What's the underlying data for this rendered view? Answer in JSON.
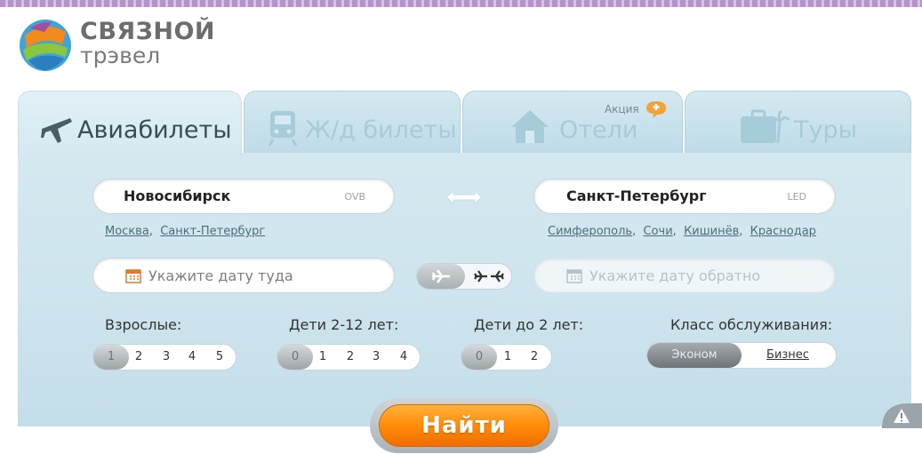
{
  "brand": {
    "name": "СВЯЗНОЙ",
    "sub": "трэвел"
  },
  "tabs": [
    {
      "label": "Авиабилеты",
      "icon": "plane-icon",
      "active": true
    },
    {
      "label": "Ж/д билеты",
      "icon": "train-icon",
      "active": false
    },
    {
      "label": "Отели",
      "icon": "house-icon",
      "active": false,
      "badge": "Акция"
    },
    {
      "label": "Туры",
      "icon": "suitcase-icon",
      "active": false
    }
  ],
  "from": {
    "city": "Новосибирск",
    "code": "OVB",
    "quick": [
      "Москва",
      "Санкт-Петербург"
    ]
  },
  "to": {
    "city": "Санкт-Петербург",
    "code": "LED",
    "quick": [
      "Симферополь",
      "Сочи",
      "Кишинёв",
      "Краснодар"
    ]
  },
  "dates": {
    "depart_placeholder": "Укажите дату туда",
    "return_placeholder": "Укажите дату обратно"
  },
  "passengers": {
    "adults": {
      "label": "Взрослые:",
      "options": [
        "1",
        "2",
        "3",
        "4",
        "5"
      ],
      "selected": "1"
    },
    "children": {
      "label": "Дети 2-12 лет:",
      "options": [
        "0",
        "1",
        "2",
        "3",
        "4"
      ],
      "selected": "0"
    },
    "infants": {
      "label": "Дети до 2 лет:",
      "options": [
        "0",
        "1",
        "2"
      ],
      "selected": "0"
    }
  },
  "service_class": {
    "label": "Класс обслуживания:",
    "economy": "Эконом",
    "business": "Бизнес",
    "selected": "Эконом"
  },
  "search": {
    "label": "Найти"
  },
  "colors": {
    "accent": "#ff8d0a",
    "panel": "#d5e8f0",
    "link": "#4f6d7b"
  }
}
